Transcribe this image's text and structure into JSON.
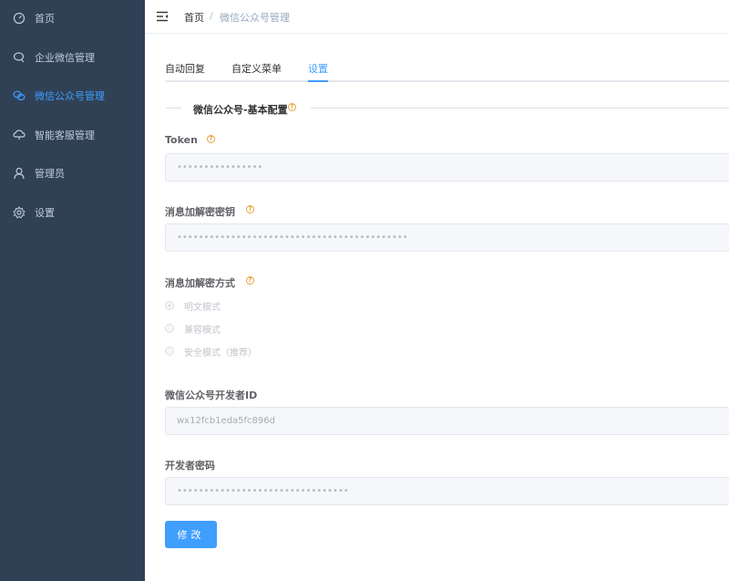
{
  "sidebar": {
    "items": [
      {
        "label": "首页",
        "icon": "dashboard-icon"
      },
      {
        "label": "企业微信管理",
        "icon": "chat-bubble-icon"
      },
      {
        "label": "微信公众号管理",
        "icon": "wechat-icon",
        "active": true
      },
      {
        "label": "智能客服管理",
        "icon": "cloud-service-icon"
      },
      {
        "label": "管理员",
        "icon": "user-icon"
      },
      {
        "label": "设置",
        "icon": "gear-icon"
      }
    ],
    "background": "#304156",
    "active_color": "#409eff"
  },
  "header": {
    "breadcrumb": {
      "home": "首页",
      "separator": "/",
      "current": "微信公众号管理"
    }
  },
  "tabs": [
    {
      "label": "自动回复"
    },
    {
      "label": "自定义菜单"
    },
    {
      "label": "设置",
      "active": true
    }
  ],
  "form": {
    "section_title": "微信公众号-基本配置",
    "token": {
      "label": "Token",
      "value": "••••••••••••••••"
    },
    "aes_key": {
      "label": "消息加解密密钥",
      "value": "•••••••••••••••••••••••••••••••••••••••••••"
    },
    "encrypt_mode": {
      "label": "消息加解密方式",
      "options": [
        "明文模式",
        "兼容模式",
        "安全模式（推荐）"
      ],
      "selected": "明文模式"
    },
    "app_id": {
      "label": "微信公众号开发者ID",
      "value": "wx12fcb1eda5fc896d"
    },
    "app_secret": {
      "label": "开发者密码",
      "value": "••••••••••••••••••••••••••••••••"
    },
    "submit_label": "修改"
  },
  "help_icon_glyph": "?",
  "colors": {
    "primary": "#409eff",
    "help": "#e6a23c"
  }
}
